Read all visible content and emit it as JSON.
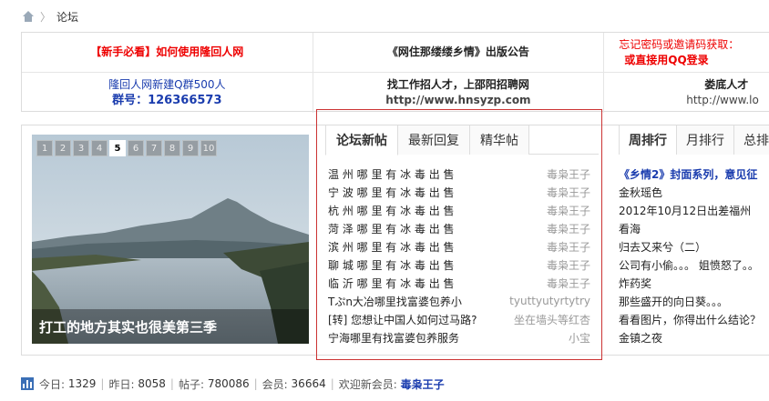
{
  "breadcrumb": {
    "current": "论坛"
  },
  "notice": {
    "row1": {
      "c1": "【新手必看】如何使用隆回人网",
      "c2": "《网住那缕缕乡情》出版公告",
      "c3a": "忘记密码或邀请码获取：",
      "c3b": "或直接用QQ登录"
    },
    "row2": {
      "c1a": "隆回人网新建Q群500人",
      "c1b": "群号：126366573",
      "c2a": "找工作招人才，上邵阳招聘网",
      "c2b": "http://www.hnsyzp.com",
      "c3a": "娄底人才",
      "c3b": "http://www.lo"
    }
  },
  "slideshow": {
    "pages": [
      "1",
      "2",
      "3",
      "4",
      "5",
      "6",
      "7",
      "8",
      "9",
      "10"
    ],
    "active_page": "5",
    "caption": "打工的地方其实也很美第三季"
  },
  "tabs": [
    "论坛新帖",
    "最新回复",
    "精华帖"
  ],
  "posts": [
    {
      "title": "温 州 哪 里 有 冰 毒 出 售",
      "author": "毒枭王子"
    },
    {
      "title": "宁 波 哪 里 有 冰 毒 出 售",
      "author": "毒枭王子"
    },
    {
      "title": "杭 州 哪 里 有 冰 毒 出 售",
      "author": "毒枭王子"
    },
    {
      "title": "菏 泽 哪 里 有 冰 毒 出 售",
      "author": "毒枭王子"
    },
    {
      "title": "滨 州 哪 里 有 冰 毒 出 售",
      "author": "毒枭王子"
    },
    {
      "title": "聊 城 哪 里 有 冰 毒 出 售",
      "author": "毒枭王子"
    },
    {
      "title": "临 沂 哪 里 有 冰 毒 出 售",
      "author": "毒枭王子"
    },
    {
      "title": "Tぷn大冶哪里找富婆包养小",
      "author": "tyuttyutyrtytry"
    },
    {
      "title": "[转] 您想让中国人如何过马路?",
      "author": "坐在墙头等红杏"
    },
    {
      "title": "宁海哪里有找富婆包养服务",
      "author": "小宝"
    }
  ],
  "rank_tabs": [
    "周排行",
    "月排行",
    "总排"
  ],
  "rank_items": [
    "《乡情2》封面系列，意见征",
    "金秋瑶色",
    "2012年10月12日出差福州",
    "看海",
    "归去又来兮（二）",
    "公司有小偷。。。 姐愤怒了。。",
    "炸药奖",
    "那些盛开的向日葵。。。",
    "看看图片，你得出什么结论？",
    "金镇之夜"
  ],
  "stats": {
    "today_label": "今日:",
    "today": "1329",
    "yesterday_label": "昨日:",
    "yesterday": "8058",
    "posts_label": "帖子:",
    "posts": "780086",
    "members_label": "会员:",
    "members": "36664",
    "welcome_label": "欢迎新会员:",
    "newest_member": "毒枭王子"
  }
}
